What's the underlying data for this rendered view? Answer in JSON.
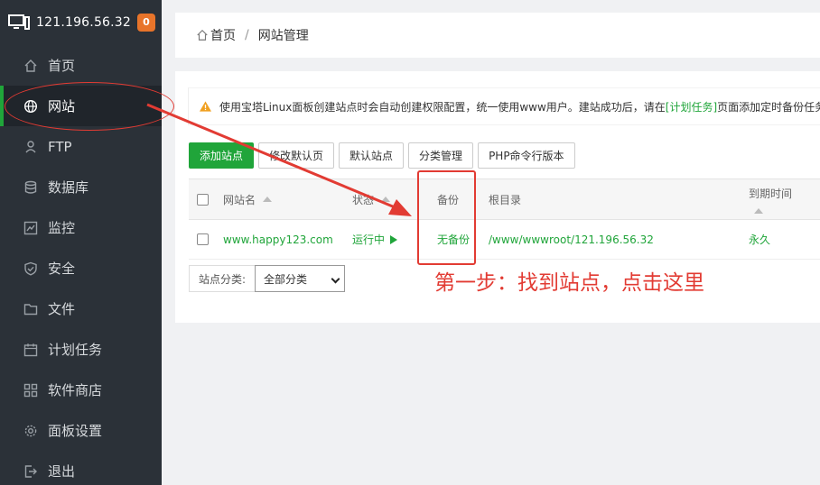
{
  "server": {
    "ip": "121.196.56.32",
    "badge": "0"
  },
  "nav": [
    {
      "label": "首页",
      "icon": "home-icon"
    },
    {
      "label": "网站",
      "icon": "globe-icon"
    },
    {
      "label": "FTP",
      "icon": "ftp-icon"
    },
    {
      "label": "数据库",
      "icon": "database-icon"
    },
    {
      "label": "监控",
      "icon": "monitor-chart-icon"
    },
    {
      "label": "安全",
      "icon": "shield-icon"
    },
    {
      "label": "文件",
      "icon": "folder-icon"
    },
    {
      "label": "计划任务",
      "icon": "calendar-icon"
    },
    {
      "label": "软件商店",
      "icon": "grid-apps-icon"
    },
    {
      "label": "面板设置",
      "icon": "gear-icon"
    },
    {
      "label": "退出",
      "icon": "logout-icon"
    }
  ],
  "breadcrumb": {
    "home": "首页",
    "sep": "/",
    "current": "网站管理"
  },
  "notice": {
    "text_before": "使用宝塔Linux面板创建站点时会自动创建权限配置，统一使用www用户。建站成功后，请在",
    "link": "[计划任务]",
    "text_after": "页面添加定时备份任务"
  },
  "toolbar": {
    "add_site": "添加站点",
    "modify_default_page": "修改默认页",
    "default_site": "默认站点",
    "category_manage": "分类管理",
    "php_cli_version": "PHP命令行版本"
  },
  "table": {
    "headers": {
      "name": "网站名",
      "status": "状态",
      "backup": "备份",
      "root": "根目录",
      "expire": "到期时间"
    },
    "rows": [
      {
        "name": "www.happy123.com",
        "status": "运行中",
        "backup": "无备份",
        "root": "/www/wwwroot/121.196.56.32",
        "expire": "永久"
      }
    ]
  },
  "filter": {
    "label": "站点分类:",
    "selected": "全部分类"
  },
  "annotation": {
    "text": "第一步：找到站点，点击这里",
    "color": "#e23b33"
  },
  "colors": {
    "accent": "#20a53a",
    "sidebar": "#2b3138",
    "badge": "#e8742a"
  }
}
